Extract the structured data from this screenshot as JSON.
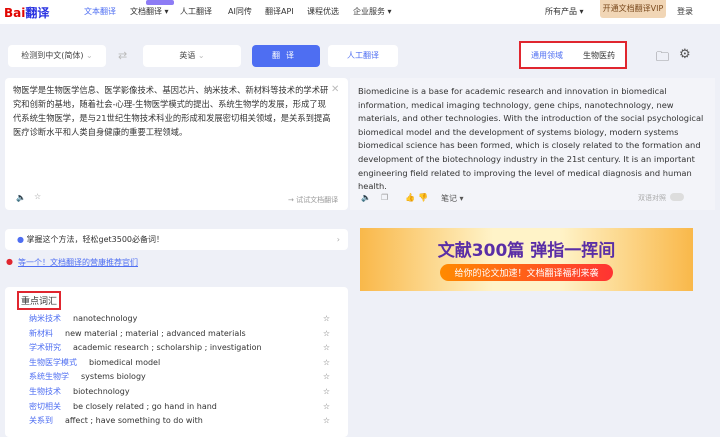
{
  "nav": {
    "logo": "Bai",
    "logo2": "翻译",
    "items": [
      "文本翻译",
      "文档翻译 ▾",
      "人工翻译",
      "AI同传",
      "翻译API",
      "课程优选",
      "企业服务 ▾"
    ],
    "all_products": "所有产品 ▾",
    "vip": "开通文档翻译VIP",
    "login": "登录"
  },
  "toolbar": {
    "source_lang": "检测到中文(简体)",
    "target_lang": "英语",
    "translate": "翻译",
    "human": "人工翻译",
    "domain_general": "通用领域",
    "domain_selected": "生物医药"
  },
  "source": {
    "text": "物医学是生物医学信息、医学影像技术、基因芯片、纳米技术、新材料等技术的学术研究和创新的基地，随着社会-心理-生物医学模式的提出、系统生物学的发展，形成了现代系统生物医学，是与21世纪生物技术科业的形成和发展密切相关领域，是关系到提高医疗诊断水平和人类自身健康的重要工程领域。",
    "try_doc": "→ 试试文档翻译"
  },
  "target": {
    "text": "Biomedicine is a base for academic research and innovation in biomedical information, medical imaging technology, gene chips, nanotechnology, new materials, and other technologies. With the introduction of the social psychological biomedical model and the development of systems biology, modern systems biomedical science has been formed, which is closely related to the formation and development of the biotechnology industry in the 21st century. It is an important engineering field related to improving the level of medical diagnosis and human health.",
    "notes": "笔记 ▾",
    "bilingual": "双语对照"
  },
  "tip": {
    "text": "掌握这个方法，轻松get3500必备词！"
  },
  "promo_link": "等一个！文档翻译的营康推荐官们",
  "vocab": {
    "title": "重点词汇",
    "items": [
      {
        "zh": "纳米技术",
        "en": "nanotechnology"
      },
      {
        "zh": "新材料",
        "en": "new material ; material ; advanced materials"
      },
      {
        "zh": "学术研究",
        "en": "academic research ; scholarship ; investigation"
      },
      {
        "zh": "生物医学模式",
        "en": "biomedical model"
      },
      {
        "zh": "系统生物学",
        "en": "systems biology"
      },
      {
        "zh": "生物技术",
        "en": "biotechnology"
      },
      {
        "zh": "密切相关",
        "en": "be closely related ; go hand in hand"
      },
      {
        "zh": "关系到",
        "en": "affect ; have something to do with"
      }
    ]
  },
  "banner": {
    "title": "文献300篇  弹指一挥间",
    "subtitle": "给你的论文加速！文档翻译福利来袭"
  }
}
